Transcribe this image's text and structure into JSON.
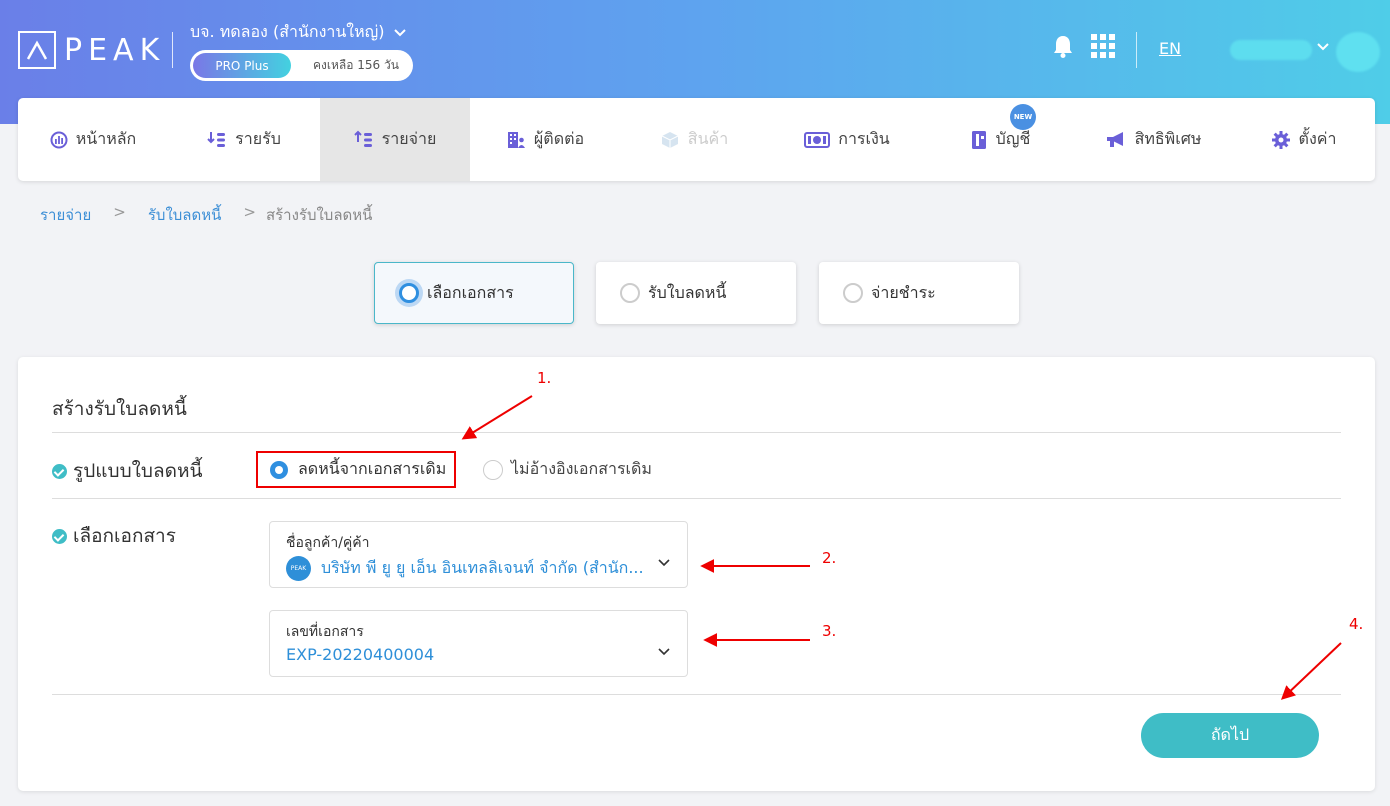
{
  "header": {
    "logo_text": "PEAK",
    "company": "บจ. ทดลอง (สำนักงานใหญ่)",
    "plan": "PRO Plus",
    "remaining": "คงเหลือ 156 วัน",
    "lang": "EN"
  },
  "nav": {
    "items": [
      {
        "label": "หน้าหลัก"
      },
      {
        "label": "รายรับ"
      },
      {
        "label": "รายจ่าย"
      },
      {
        "label": "ผู้ติดต่อ"
      },
      {
        "label": "สินค้า"
      },
      {
        "label": "การเงิน"
      },
      {
        "label": "บัญชี"
      },
      {
        "label": "สิทธิพิเศษ"
      },
      {
        "label": "ตั้งค่า"
      }
    ],
    "new_badge": "NEW"
  },
  "breadcrumb": {
    "items": [
      "รายจ่าย",
      "รับใบลดหนี้",
      "สร้างรับใบลดหนี้"
    ],
    "sep": ">"
  },
  "steps": [
    {
      "label": "เลือกเอกสาร"
    },
    {
      "label": "รับใบลดหนี้"
    },
    {
      "label": "จ่ายชำระ"
    }
  ],
  "form": {
    "title": "สร้างรับใบลดหนี้",
    "format_label": "รูปแบบใบลดหนี้",
    "option_from_doc": "ลดหนี้จากเอกสารเดิม",
    "option_no_ref": "ไม่อ้างอิงเอกสารเดิม",
    "select_doc_label": "เลือกเอกสาร",
    "customer_field_label": "ชื่อลูกค้า/คู่ค้า",
    "customer_value": "บริษัท พี ยู ยู เอ็น อินเทลลิเจนท์ จำกัด (สำนัก...",
    "docno_field_label": "เลขที่เอกสาร",
    "docno_value": "EXP-20220400004",
    "next_button": "ถัดไป"
  },
  "annotations": [
    "1.",
    "2.",
    "3.",
    "4."
  ],
  "colors": {
    "accent": "#3fbdc6",
    "link": "#3d8fd6",
    "annotation": "#e00000"
  }
}
